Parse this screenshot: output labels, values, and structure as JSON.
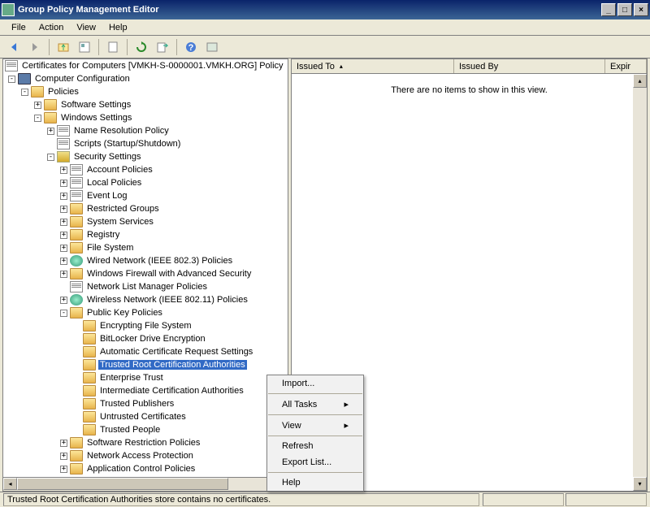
{
  "window": {
    "title": "Group Policy Management Editor"
  },
  "menu": {
    "file": "File",
    "action": "Action",
    "view": "View",
    "help": "Help"
  },
  "tree_root": "Certificates for Computers [VMKH-S-0000001.VMKH.ORG] Policy",
  "tree": {
    "computer_config": "Computer Configuration",
    "policies": "Policies",
    "software": "Software Settings",
    "windows": "Windows Settings",
    "name_res": "Name Resolution Policy",
    "scripts": "Scripts (Startup/Shutdown)",
    "security": "Security Settings",
    "account": "Account Policies",
    "local": "Local Policies",
    "eventlog": "Event Log",
    "restricted": "Restricted Groups",
    "sysserv": "System Services",
    "registry": "Registry",
    "filesys": "File System",
    "wired": "Wired Network (IEEE 802.3) Policies",
    "firewall": "Windows Firewall with Advanced Security",
    "netlist": "Network List Manager Policies",
    "wireless": "Wireless Network (IEEE 802.11) Policies",
    "pki": "Public Key Policies",
    "efs": "Encrypting File System",
    "bitlocker": "BitLocker Drive Encryption",
    "autocert": "Automatic Certificate Request Settings",
    "trustedroot": "Trusted Root Certification Authorities",
    "enttrust": "Enterprise Trust",
    "intermed": "Intermediate Certification Authorities",
    "trustedpub": "Trusted Publishers",
    "untrusted": "Untrusted Certificates",
    "trustedppl": "Trusted People",
    "softrestr": "Software Restriction Policies",
    "nap": "Network Access Protection",
    "appctrl": "Application Control Policies"
  },
  "columns": {
    "issued_to": "Issued To",
    "issued_by": "Issued By",
    "expir": "Expir"
  },
  "list_empty": "There are no items to show in this view.",
  "context": {
    "import": "Import...",
    "alltasks": "All Tasks",
    "view": "View",
    "refresh": "Refresh",
    "export": "Export List...",
    "help": "Help"
  },
  "status": "Trusted Root Certification Authorities store contains no certificates."
}
